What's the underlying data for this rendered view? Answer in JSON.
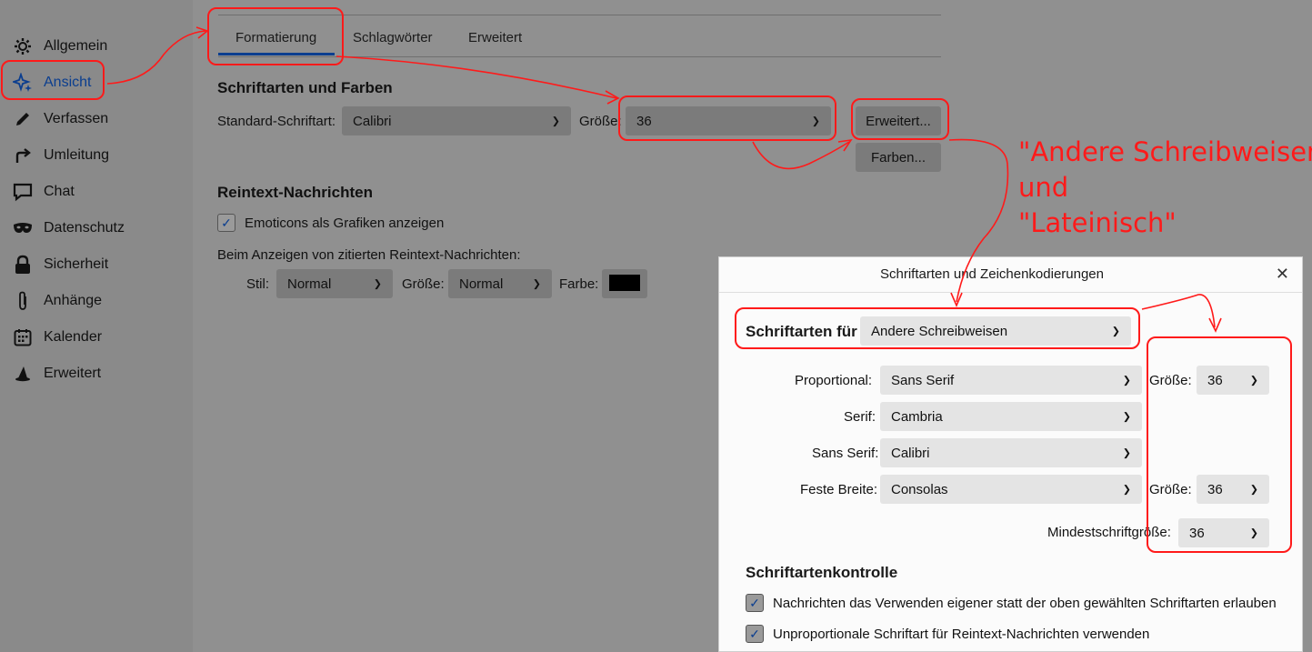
{
  "sidebar": {
    "items": [
      {
        "label": "Allgemein",
        "icon": "gear-icon"
      },
      {
        "label": "Ansicht",
        "icon": "sparkle-icon",
        "active": true
      },
      {
        "label": "Verfassen",
        "icon": "pencil-icon"
      },
      {
        "label": "Umleitung",
        "icon": "redirect-icon"
      },
      {
        "label": "Chat",
        "icon": "chat-bubble-icon"
      },
      {
        "label": "Datenschutz",
        "icon": "mask-icon"
      },
      {
        "label": "Sicherheit",
        "icon": "lock-icon"
      },
      {
        "label": "Anhänge",
        "icon": "paperclip-icon"
      },
      {
        "label": "Kalender",
        "icon": "calendar-icon"
      },
      {
        "label": "Erweitert",
        "icon": "wizard-hat-icon"
      }
    ]
  },
  "tabs": [
    {
      "label": "Formatierung",
      "active": true
    },
    {
      "label": "Schlagwörter"
    },
    {
      "label": "Erweitert"
    }
  ],
  "fonts_section": {
    "heading": "Schriftarten und Farben",
    "default_font_label": "Standard-Schriftart:",
    "default_font_value": "Calibri",
    "size_label": "Größe:",
    "size_value": "36",
    "advanced_button": "Erweitert...",
    "colors_button": "Farben..."
  },
  "plaintext_section": {
    "heading": "Reintext-Nachrichten",
    "emoticons_label": "Emoticons als Grafiken anzeigen",
    "emoticons_checked": true,
    "quoted_label": "Beim Anzeigen von zitierten Reintext-Nachrichten:",
    "style_label": "Stil:",
    "style_value": "Normal",
    "size_label": "Größe:",
    "size_value": "Normal",
    "color_label": "Farbe:",
    "color_value": "#000000"
  },
  "annotation": {
    "text": "\"Andere Schreibweisen\"\nund\n\"Lateinisch\"",
    "color": "#ff1a1a"
  },
  "dialog": {
    "title": "Schriftarten und Zeichenkodierungen",
    "close": "✕",
    "fonts_for_label": "Schriftarten für",
    "fonts_for_value": "Andere Schreibweisen",
    "proportional_label": "Proportional:",
    "proportional_value": "Sans Serif",
    "proportional_size_label": "Größe:",
    "proportional_size_value": "36",
    "serif_label": "Serif:",
    "serif_value": "Cambria",
    "sans_serif_label": "Sans Serif:",
    "sans_serif_value": "Calibri",
    "monospace_label": "Feste Breite:",
    "monospace_value": "Consolas",
    "monospace_size_label": "Größe:",
    "monospace_size_value": "36",
    "min_size_label": "Mindestschriftgröße:",
    "min_size_value": "36",
    "control_heading": "Schriftartenkontrolle",
    "allow_own_label": "Nachrichten das Verwenden eigener statt der oben gewählten Schriftarten erlauben",
    "allow_own_checked": true,
    "monospace_plain_label": "Unproportionale Schriftart für Reintext-Nachrichten verwenden",
    "monospace_plain_checked": true
  },
  "colors": {
    "accent": "#0b3e8f",
    "annotation": "#ff1a1a",
    "overlay": "#8d8d8d"
  }
}
